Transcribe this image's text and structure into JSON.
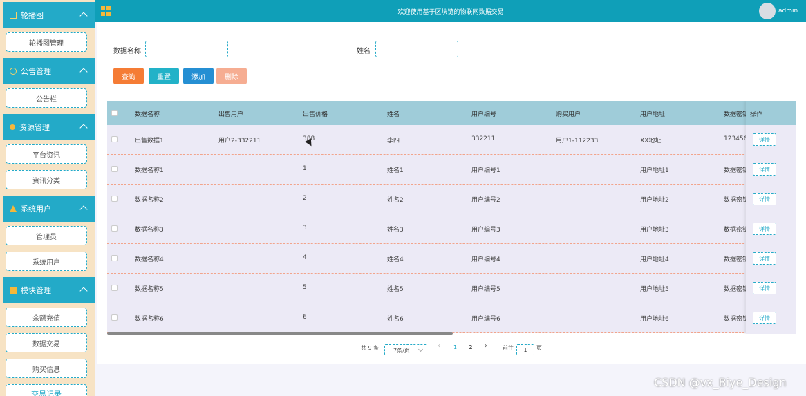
{
  "sidebar": {
    "groups": [
      {
        "title": "轮播图",
        "items": [
          "轮播图管理"
        ]
      },
      {
        "title": "公告管理",
        "items": [
          "公告栏"
        ]
      },
      {
        "title": "资源管理",
        "items": [
          "平台资讯",
          "资讯分类"
        ]
      },
      {
        "title": "系统用户",
        "items": [
          "管理员",
          "系统用户"
        ]
      },
      {
        "title": "模块管理",
        "items": [
          "余额充值",
          "数据交易",
          "购买信息",
          "交易记录"
        ]
      }
    ]
  },
  "topbar": {
    "title": "欢迎使用基于区块链的物联网数据交易",
    "user": "admin"
  },
  "search": {
    "field1_label": "数据名称",
    "field2_label": "姓名"
  },
  "buttons": {
    "query": "查询",
    "reset": "重置",
    "add": "添加",
    "delete": "删除"
  },
  "table": {
    "headers": [
      "数据名称",
      "出售用户",
      "出售价格",
      "姓名",
      "用户编号",
      "购买用户",
      "用户地址",
      "数据密钥",
      "操作"
    ],
    "rows": [
      [
        "出售数据1",
        "用户2-332211",
        "388",
        "李四",
        "332211",
        "用户1-112233",
        "XX地址",
        "123456"
      ],
      [
        "数据名称1",
        "",
        "1",
        "姓名1",
        "用户编号1",
        "",
        "用户地址1",
        "数据密钥"
      ],
      [
        "数据名称2",
        "",
        "2",
        "姓名2",
        "用户编号2",
        "",
        "用户地址2",
        "数据密钥"
      ],
      [
        "数据名称3",
        "",
        "3",
        "姓名3",
        "用户编号3",
        "",
        "用户地址3",
        "数据密钥"
      ],
      [
        "数据名称4",
        "",
        "4",
        "姓名4",
        "用户编号4",
        "",
        "用户地址4",
        "数据密钥"
      ],
      [
        "数据名称5",
        "",
        "5",
        "姓名5",
        "用户编号5",
        "",
        "用户地址5",
        "数据密钥"
      ],
      [
        "数据名称6",
        "",
        "6",
        "姓名6",
        "用户编号6",
        "",
        "用户地址6",
        "数据密钥"
      ]
    ],
    "detail_label": "详情"
  },
  "pagination": {
    "total": "共 9 条",
    "page_size": "7条/页",
    "pages": [
      "1",
      "2"
    ],
    "current_page": "1",
    "goto_prefix": "前往",
    "goto_value": "1",
    "goto_suffix": "页"
  },
  "watermark": "CSDN @vx_Biye_Design",
  "colors": {
    "accent": "#23aac8",
    "topbar": "#0f9fb8",
    "sidebar_bg": "#f7e3c4",
    "query": "#f57c35",
    "reset": "#22b2c8",
    "add": "#258fd3",
    "delete": "#f6ad92"
  }
}
